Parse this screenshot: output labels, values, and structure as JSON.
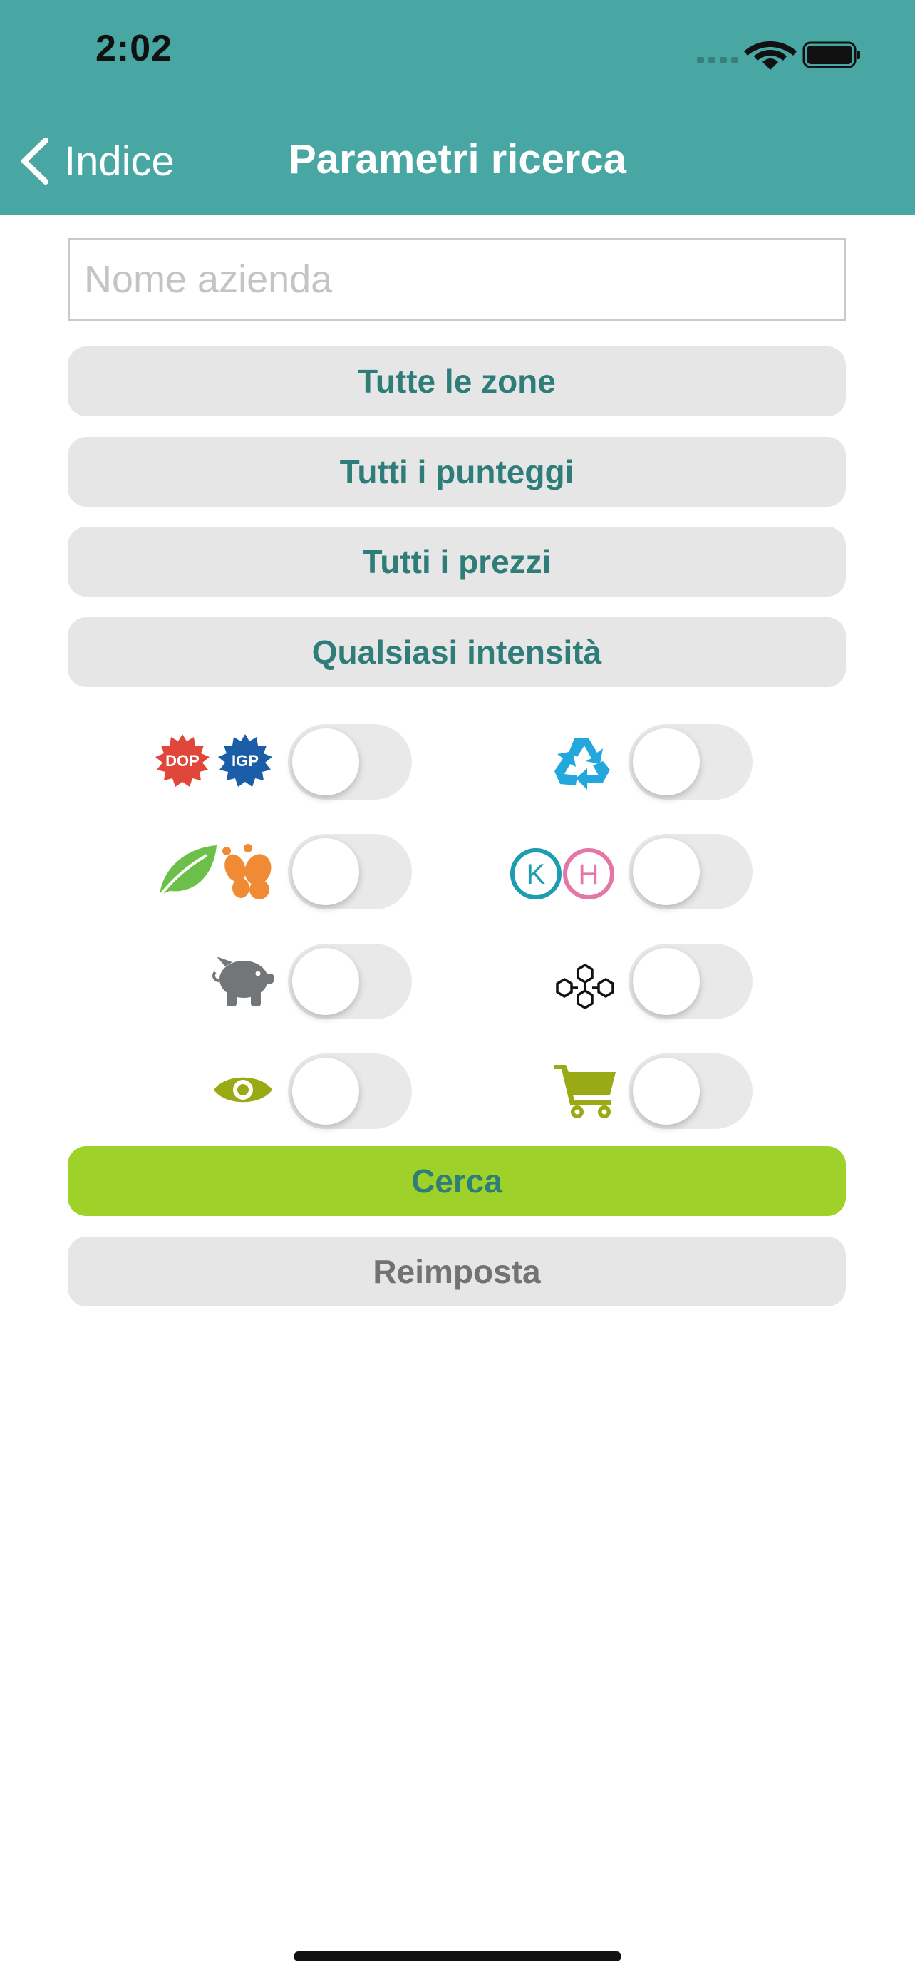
{
  "status_bar": {
    "time": "2:02"
  },
  "nav": {
    "back_label": "Indice",
    "title": "Parametri ricerca"
  },
  "form": {
    "company_name": {
      "placeholder": "Nome azienda",
      "value": ""
    },
    "zones_button": "Tutte le zone",
    "scores_button": "Tutti i punteggi",
    "prices_button": "Tutti i prezzi",
    "intensity_button": "Qualsiasi intensità",
    "search_button": "Cerca",
    "reset_button": "Reimposta"
  },
  "filters": [
    {
      "id": "dop-igp",
      "icon_texts": [
        "DOP",
        "IGP"
      ],
      "on": false
    },
    {
      "id": "recycle",
      "icon": "recycle-icon",
      "on": false
    },
    {
      "id": "organic-biodynamic",
      "icon": "leaf-butterfly-icon",
      "on": false
    },
    {
      "id": "kosher-halal",
      "icon_texts": [
        "K",
        "H"
      ],
      "on": false
    },
    {
      "id": "savings",
      "icon": "piggy-bank-icon",
      "on": false
    },
    {
      "id": "network",
      "icon": "cubes-network-icon",
      "on": false
    },
    {
      "id": "visible",
      "icon": "eye-icon",
      "on": false
    },
    {
      "id": "shop",
      "icon": "shopping-cart-icon",
      "on": false
    }
  ],
  "colors": {
    "header": "#48a6a3",
    "accent_text": "#2f7d79",
    "search_button": "#9ed22a",
    "pill_background": "#e6e6e6"
  }
}
